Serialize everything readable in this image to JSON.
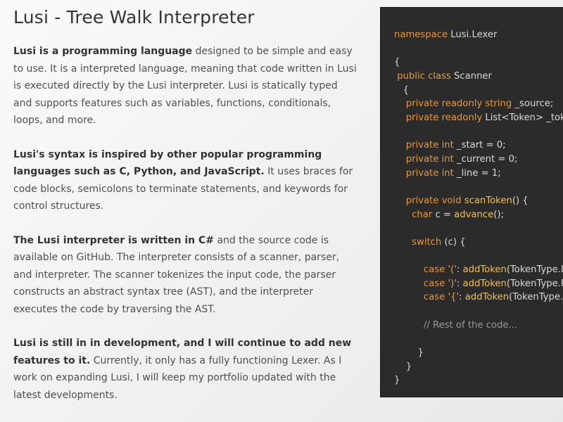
{
  "page": {
    "title": "Lusi - Tree Walk Interpreter"
  },
  "paragraphs": [
    {
      "bold": "Lusi is a programming language",
      "text": " designed to be simple and easy to use. It is a interpreted language, meaning that code written in Lusi is executed directly by the Lusi interpreter. Lusi is statically typed and supports features such as variables, functions, conditionals, loops, and more."
    },
    {
      "bold": "Lusi's syntax is inspired by other popular programming languages such as C, Python, and JavaScript.",
      "text": " It uses braces for code blocks, semicolons to terminate statements, and keywords for control structures."
    },
    {
      "bold": "The Lusi interpreter is written in C#",
      "text": " and the source code is available on GitHub. The interpreter consists of a scanner, parser, and interpreter. The scanner tokenizes the input code, the parser constructs an abstract syntax tree (AST), and the interpreter executes the code by traversing the AST."
    },
    {
      "bold": "Lusi is still in in development, and I will continue to add new features to it.",
      "text": " Currently, it only has a fully functioning Lexer. As I work on expanding Lusi, I will keep my portfolio updated with the latest developments."
    }
  ],
  "code": {
    "lines": [
      [
        {
          "t": "namespace",
          "c": "k"
        },
        {
          "t": " Lusi.Lexer"
        }
      ],
      [],
      [
        {
          "t": "{"
        }
      ],
      [
        {
          "t": " "
        },
        {
          "t": "public class",
          "c": "k"
        },
        {
          "t": " Scanner"
        }
      ],
      [
        {
          "t": "   {"
        }
      ],
      [
        {
          "t": "    "
        },
        {
          "t": "private readonly string",
          "c": "k"
        },
        {
          "t": " _source;"
        }
      ],
      [
        {
          "t": "    "
        },
        {
          "t": "private readonly",
          "c": "k"
        },
        {
          "t": " List<Token> _tokens"
        }
      ],
      [],
      [
        {
          "t": "    "
        },
        {
          "t": "private int",
          "c": "k"
        },
        {
          "t": " _start = 0;"
        }
      ],
      [
        {
          "t": "    "
        },
        {
          "t": "private int",
          "c": "k"
        },
        {
          "t": " _current = 0;"
        }
      ],
      [
        {
          "t": "    "
        },
        {
          "t": "private int",
          "c": "k"
        },
        {
          "t": " _line = 1;"
        }
      ],
      [],
      [
        {
          "t": "    "
        },
        {
          "t": "private void",
          "c": "k"
        },
        {
          "t": " "
        },
        {
          "t": "scanToken",
          "c": "f"
        },
        {
          "t": "() {"
        }
      ],
      [
        {
          "t": "      "
        },
        {
          "t": "char",
          "c": "k"
        },
        {
          "t": " c = "
        },
        {
          "t": "advance",
          "c": "f"
        },
        {
          "t": "();"
        }
      ],
      [],
      [
        {
          "t": "      "
        },
        {
          "t": "switch",
          "c": "k"
        },
        {
          "t": " (c) {"
        }
      ],
      [],
      [
        {
          "t": "          "
        },
        {
          "t": "case",
          "c": "k"
        },
        {
          "t": " "
        },
        {
          "t": "'('",
          "c": "s"
        },
        {
          "t": ": "
        },
        {
          "t": "addToken",
          "c": "f"
        },
        {
          "t": "(TokenType.LEFT_PAREN); break;"
        }
      ],
      [
        {
          "t": "          "
        },
        {
          "t": "case",
          "c": "k"
        },
        {
          "t": " "
        },
        {
          "t": "')'",
          "c": "s"
        },
        {
          "t": ": "
        },
        {
          "t": "addToken",
          "c": "f"
        },
        {
          "t": "(TokenType.RIGHT_PAREN); break;"
        }
      ],
      [
        {
          "t": "          "
        },
        {
          "t": "case",
          "c": "k"
        },
        {
          "t": " "
        },
        {
          "t": "'{'",
          "c": "s"
        },
        {
          "t": ": "
        },
        {
          "t": "addToken",
          "c": "f"
        },
        {
          "t": "(TokenType.LEFT_BRACE); break;"
        }
      ],
      [],
      [
        {
          "t": "          "
        },
        {
          "t": "// Rest of the code...",
          "c": "c"
        }
      ],
      [],
      [
        {
          "t": "        }"
        }
      ],
      [
        {
          "t": "    }"
        }
      ],
      [
        {
          "t": "}"
        }
      ]
    ]
  },
  "colors": {
    "keyword": "#e5973b",
    "function": "#f0bf5a",
    "string": "#e5a060",
    "comment": "#9a9a9a",
    "code_background": "#2b2b2b"
  }
}
